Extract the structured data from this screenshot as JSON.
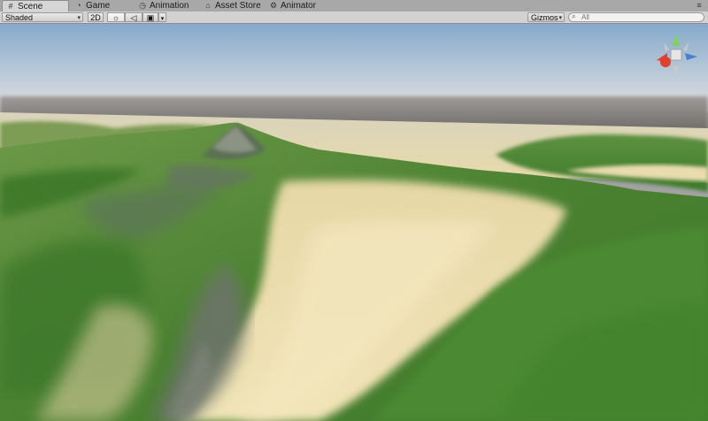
{
  "tabs": [
    {
      "label": "Scene",
      "icon": "grid-icon",
      "active": true
    },
    {
      "label": "Game",
      "icon": "pacman-icon",
      "active": false
    },
    {
      "label": "Animation",
      "icon": "clock-icon",
      "active": false
    },
    {
      "label": "Asset Store",
      "icon": "store-icon",
      "active": false
    },
    {
      "label": "Animator",
      "icon": "animator-icon",
      "active": false
    }
  ],
  "toolbar": {
    "shading_mode": "Shaded",
    "mode_2d_label": "2D",
    "lighting_icon": "sun-icon",
    "audio_icon": "speaker-icon",
    "effects_icon": "image-icon",
    "gizmos_label": "Gizmos",
    "search_placeholder": "All"
  },
  "scene_gizmo": {
    "axes": [
      "y",
      "x",
      "z"
    ],
    "colors": {
      "y": "#7fd25a",
      "x": "#e0402e",
      "z": "#4a80d0",
      "center": "#e6e6e6"
    }
  },
  "colors": {
    "sky_top": "#8fb0d0",
    "sky_horizon": "#d9dde4",
    "sand": "#e8dcac",
    "grass": "#4e8b34",
    "rock": "#6f7a6a"
  }
}
